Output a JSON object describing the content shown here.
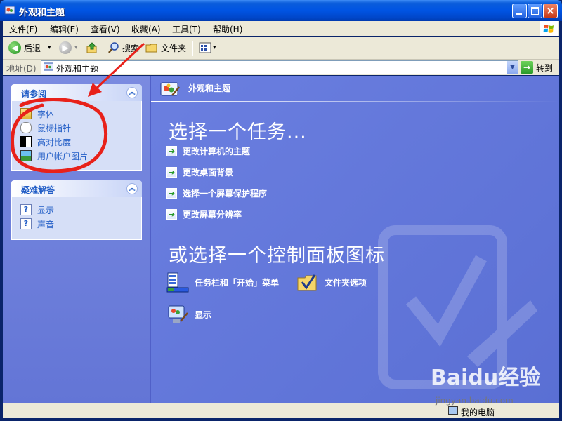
{
  "window": {
    "title": "外观和主题",
    "close_glyph": "×"
  },
  "menubar": {
    "items": [
      "文件(F)",
      "编辑(E)",
      "查看(V)",
      "收藏(A)",
      "工具(T)",
      "帮助(H)"
    ]
  },
  "toolbar": {
    "back_label": "后退",
    "back_glyph": "◀",
    "fwd_glyph": "▶",
    "search_label": "搜索",
    "folders_label": "文件夹",
    "dropdown_glyph": "▾"
  },
  "addressbar": {
    "label": "地址(D)",
    "value": "外观和主题",
    "go_label": "转到",
    "go_glyph": "→",
    "drop_glyph": "▼"
  },
  "sidebar": {
    "see_also": {
      "title": "请参阅",
      "collapse_glyph": "︽",
      "links": [
        {
          "label": "字体",
          "icon": "font-folder-icon"
        },
        {
          "label": "鼠标指针",
          "icon": "mouse-icon"
        },
        {
          "label": "高对比度",
          "icon": "contrast-icon"
        },
        {
          "label": "用户帐户图片",
          "icon": "picture-icon"
        }
      ]
    },
    "troubleshoot": {
      "title": "疑难解答",
      "collapse_glyph": "︽",
      "links": [
        {
          "label": "显示",
          "icon": "help-icon"
        },
        {
          "label": "声音",
          "icon": "help-icon"
        }
      ]
    }
  },
  "main": {
    "header_title": "外观和主题",
    "task_heading": "选择一个任务...",
    "task_arrow_glyph": "➔",
    "tasks": [
      "更改计算机的主题",
      "更改桌面背景",
      "选择一个屏幕保护程序",
      "更改屏幕分辨率"
    ],
    "cp_heading": "或选择一个控制面板图标",
    "cp_items": [
      {
        "label": "任务栏和「开始」菜单",
        "icon": "taskbar-icon"
      },
      {
        "label": "文件夹选项",
        "icon": "folder-options-icon"
      },
      {
        "label": "显示",
        "icon": "display-icon"
      }
    ]
  },
  "statusbar": {
    "text": "我的电脑"
  },
  "watermark": {
    "brand": "Baidu经验",
    "url": "jingyan.baidu.com"
  },
  "colors": {
    "title_blue": "#0054e3",
    "panel_link": "#215dc6",
    "content_bg": "#6375d6",
    "annotation_red": "#e8211a"
  }
}
